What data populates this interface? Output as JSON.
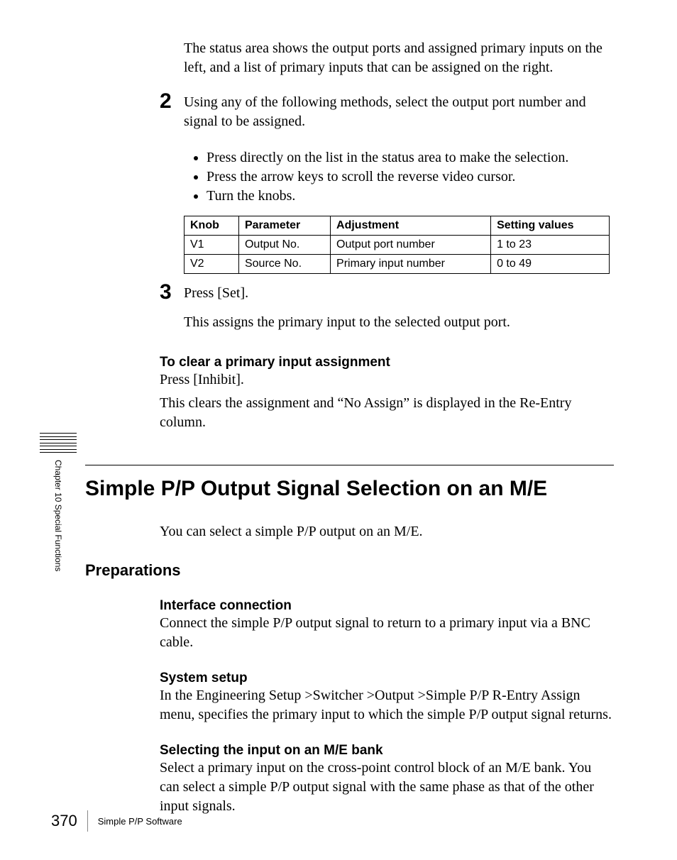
{
  "intro_text": "The status area shows the output ports and assigned primary inputs on the left, and a list of primary inputs that can be assigned on the right.",
  "step2": {
    "num": "2",
    "text": "Using any of the following methods, select the output port number and signal to be assigned.",
    "bullets": [
      "Press directly on the list in the status area to make the selection.",
      "Press the arrow keys to scroll the reverse video cursor.",
      "Turn the knobs."
    ]
  },
  "table": {
    "headers": [
      "Knob",
      "Parameter",
      "Adjustment",
      "Setting values"
    ],
    "rows": [
      [
        "V1",
        "Output No.",
        "Output port number",
        "1 to 23"
      ],
      [
        "V2",
        "Source No.",
        "Primary input number",
        "0 to 49"
      ]
    ]
  },
  "step3": {
    "num": "3",
    "text": "Press [Set].",
    "follow": "This assigns the primary input to the selected output port."
  },
  "clear": {
    "heading": "To clear a primary input assignment",
    "p1": "Press [Inhibit].",
    "p2": "This clears the assignment and “No Assign” is displayed in the Re-Entry column."
  },
  "section": {
    "title": "Simple P/P Output Signal Selection on an M/E",
    "intro": "You can select a simple P/P output on an M/E."
  },
  "preparations": {
    "title": "Preparations",
    "if_head": "Interface connection",
    "if_body": "Connect the simple P/P output signal to return to a primary input via a BNC cable.",
    "sys_head": "System setup",
    "sys_body": "In the Engineering Setup >Switcher >Output >Simple P/P R-Entry Assign menu, specifies the primary input to which the simple P/P output signal returns.",
    "sel_head": "Selecting the input on an M/E bank",
    "sel_body": "Select a primary input on the cross-point control block of an M/E bank. You can select a simple P/P output signal with the same phase as that of the other input signals."
  },
  "sidebar": "Chapter 10  Special Functions",
  "footer": {
    "page": "370",
    "text": "Simple P/P Software"
  },
  "chart_data": {
    "type": "table",
    "headers": [
      "Knob",
      "Parameter",
      "Adjustment",
      "Setting values"
    ],
    "rows": [
      {
        "Knob": "V1",
        "Parameter": "Output No.",
        "Adjustment": "Output port number",
        "Setting values": "1 to 23"
      },
      {
        "Knob": "V2",
        "Parameter": "Source No.",
        "Adjustment": "Primary input number",
        "Setting values": "0 to 49"
      }
    ]
  }
}
